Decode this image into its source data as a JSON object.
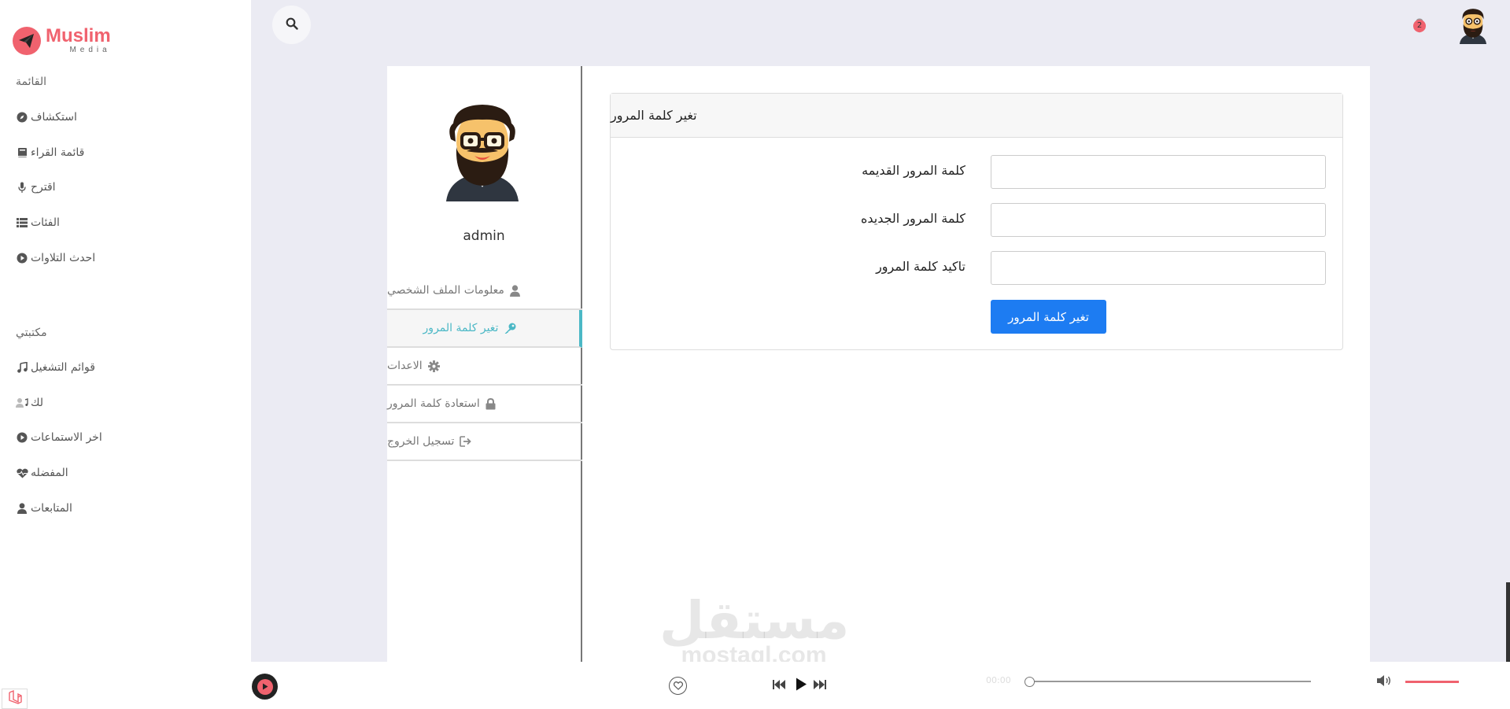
{
  "brand": {
    "name": "Muslim",
    "sub": "Media",
    "accent_color": "#f0626e"
  },
  "sidebar": {
    "menu_heading": "القائمة",
    "menu_items": [
      {
        "label": "استكشاف",
        "icon": "compass-icon"
      },
      {
        "label": "قائمة القراء",
        "icon": "book-icon"
      },
      {
        "label": "اقترح",
        "icon": "microphone-icon"
      },
      {
        "label": "الفئات",
        "icon": "list-icon"
      },
      {
        "label": "احدث التلاوات",
        "icon": "play-circle-icon"
      }
    ],
    "library_heading": "مكتبتي",
    "library_items": [
      {
        "label": "قوائم التشغيل",
        "icon": "music-icon"
      },
      {
        "label": "لك",
        "icon": "user-music-icon"
      },
      {
        "label": "اخر الاستماعات",
        "icon": "play-circle-icon"
      },
      {
        "label": "المفضله",
        "icon": "heart-pulse-icon"
      },
      {
        "label": "المتابعات",
        "icon": "user-icon"
      }
    ]
  },
  "topbar": {
    "notification_count": "2"
  },
  "profile": {
    "username": "admin",
    "menu": [
      {
        "label": "معلومات الملف الشخصي",
        "icon": "user-icon",
        "active": false
      },
      {
        "label": "تغير كلمة المرور",
        "icon": "key-icon",
        "active": true
      },
      {
        "label": "الاعدات",
        "icon": "gear-icon",
        "active": false
      },
      {
        "label": "استعادة كلمة المرور",
        "icon": "lock-icon",
        "active": false
      },
      {
        "label": "تسجيل الخروج",
        "icon": "sign-out-icon",
        "active": false
      }
    ]
  },
  "change_password": {
    "title": "تغير كلمة المرور",
    "old_label": "كلمة المرور القديمه",
    "new_label": "كلمة المرور الجديده",
    "confirm_label": "تاكيد كلمة المرور",
    "submit_label": "تغير كلمة المرور",
    "old_value": "",
    "new_value": "",
    "confirm_value": ""
  },
  "player": {
    "time_start": "00:00",
    "progress": 0,
    "volume": 1
  },
  "watermark": {
    "arabic": "مستقل",
    "latin": "mostaql.com"
  },
  "colors": {
    "primary_button": "#1d7cf2",
    "active_menu": "#4bb8c6",
    "page_bg": "#ebebf3"
  }
}
